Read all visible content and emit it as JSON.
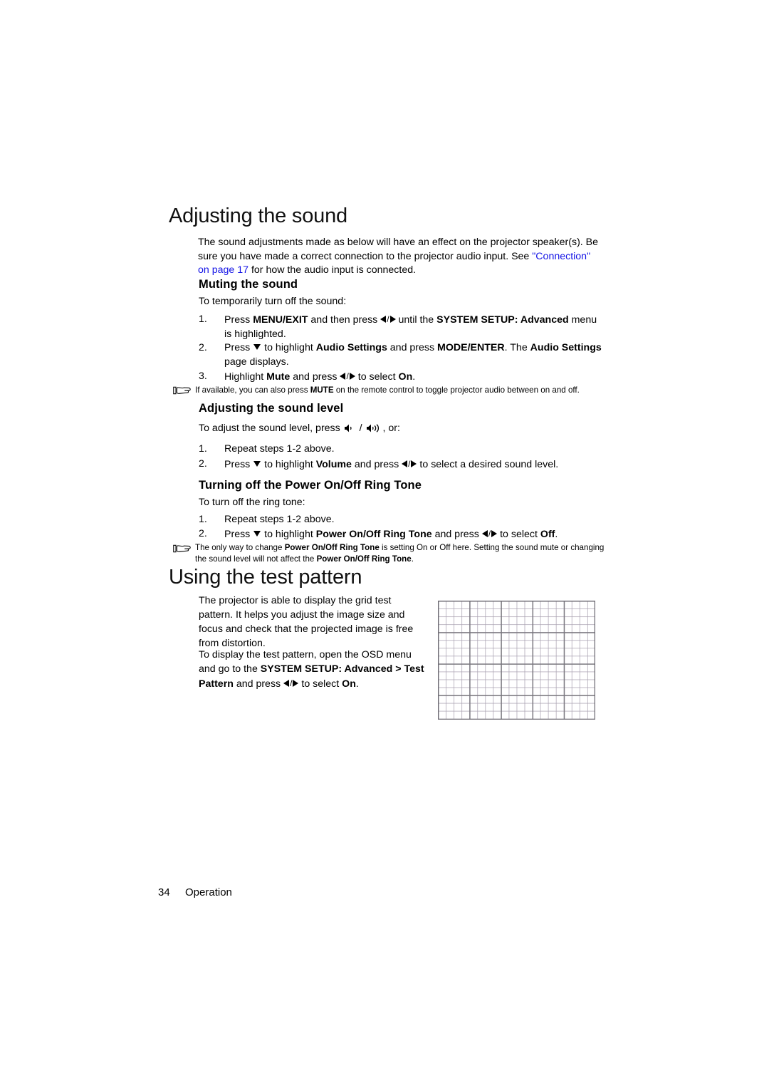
{
  "document": {
    "page_number": "34",
    "footer_section": "Operation",
    "link_color": "#1414e6"
  },
  "section_sound": {
    "title": "Adjusting the sound",
    "intro_part1": "The sound adjustments made as below will have an effect on the projector speaker(s). Be sure you have made a correct connection to the projector audio input. See ",
    "intro_link1": "\"Connection\" on page 17",
    "intro_part2": " for how the audio input is connected."
  },
  "muting": {
    "heading": "Muting the sound",
    "intro": "To temporarily turn off the sound:",
    "steps": [
      {
        "num": "1.",
        "segments": [
          {
            "t": "Press ",
            "bold": false
          },
          {
            "t": "MENU/EXIT",
            "bold": true
          },
          {
            "t": " and then press ",
            "bold": false
          },
          {
            "t": "ARROWS_LR",
            "icon": true
          },
          {
            "t": " until the ",
            "bold": false
          },
          {
            "t": "SYSTEM SETUP: Advanced",
            "bold": true
          },
          {
            "t": " menu is highlighted.",
            "bold": false
          }
        ]
      },
      {
        "num": "2.",
        "segments": [
          {
            "t": "Press ",
            "bold": false
          },
          {
            "t": "ARROW_DOWN",
            "icon": true
          },
          {
            "t": " to highlight ",
            "bold": false
          },
          {
            "t": "Audio Settings",
            "bold": true
          },
          {
            "t": " and press ",
            "bold": false
          },
          {
            "t": "MODE/ENTER",
            "bold": true
          },
          {
            "t": ". The ",
            "bold": false
          },
          {
            "t": "Audio Settings",
            "bold": true
          },
          {
            "t": " page displays.",
            "bold": false
          }
        ]
      },
      {
        "num": "3.",
        "segments": [
          {
            "t": "Highlight ",
            "bold": false
          },
          {
            "t": "Mute",
            "bold": true
          },
          {
            "t": " and press ",
            "bold": false
          },
          {
            "t": "ARROWS_LR",
            "icon": true
          },
          {
            "t": " to select ",
            "bold": false
          },
          {
            "t": "On",
            "bold": true
          },
          {
            "t": ".",
            "bold": false
          }
        ]
      }
    ],
    "note_part1": "If available, you can also press ",
    "note_bold1": "MUTE",
    "note_part2": " on the remote control to toggle projector audio between on and off."
  },
  "sound_level": {
    "heading": "Adjusting the sound level",
    "intro_part1": "To adjust the sound level, press ",
    "intro_part2": ", or:",
    "steps": [
      {
        "num": "1.",
        "segments": [
          {
            "t": "Repeat steps 1-2 above.",
            "bold": false
          }
        ]
      },
      {
        "num": "2.",
        "segments": [
          {
            "t": "Press ",
            "bold": false
          },
          {
            "t": "ARROW_DOWN",
            "icon": true
          },
          {
            "t": " to highlight ",
            "bold": false
          },
          {
            "t": "Volume",
            "bold": true
          },
          {
            "t": " and press ",
            "bold": false
          },
          {
            "t": "ARROWS_LR",
            "icon": true
          },
          {
            "t": " to select a desired sound level.",
            "bold": false
          }
        ]
      }
    ]
  },
  "ring_tone": {
    "heading": "Turning off the Power On/Off Ring Tone",
    "intro": "To turn off the ring tone:",
    "steps": [
      {
        "num": "1.",
        "segments": [
          {
            "t": "Repeat steps 1-2 above.",
            "bold": false
          }
        ]
      },
      {
        "num": "2.",
        "segments": [
          {
            "t": "Press ",
            "bold": false
          },
          {
            "t": "ARROW_DOWN",
            "icon": true
          },
          {
            "t": " to highlight ",
            "bold": false
          },
          {
            "t": "Power On/Off Ring Tone",
            "bold": true
          },
          {
            "t": " and press ",
            "bold": false
          },
          {
            "t": "ARROWS_LR",
            "icon": true
          },
          {
            "t": " to select ",
            "bold": false
          },
          {
            "t": "Off",
            "bold": true
          },
          {
            "t": ".",
            "bold": false
          }
        ]
      }
    ],
    "note_part1": "The only way to change ",
    "note_bold1": "Power On/Off Ring Tone",
    "note_part2": " is setting On or Off here. Setting the sound mute or changing the sound level will not affect the ",
    "note_bold2": "Power On/Off Ring Tone",
    "note_part3": "."
  },
  "test_pattern": {
    "title": "Using the test pattern",
    "para1": "The projector is able to display the grid test pattern. It helps you adjust the image size and focus and check that the projected image is free from distortion.",
    "para2_part1": "To display the test pattern, open the OSD menu and go to the ",
    "para2_bold1": "SYSTEM SETUP: Advanced",
    "para2_part2": " > ",
    "para2_bold2": "Test Pattern",
    "para2_part3": " and press ",
    "para2_part4": " to select ",
    "para2_bold3": "On",
    "para2_part5": ".",
    "image_alt": "grid-test-pattern"
  },
  "icons": {
    "note_pointer": "pointing-hand-icon",
    "volume_down": "speaker-volume-down-icon",
    "volume_up": "speaker-volume-up-icon",
    "arrow_left": "triangle-left-icon",
    "arrow_right": "triangle-right-icon",
    "arrow_down": "triangle-down-icon"
  }
}
